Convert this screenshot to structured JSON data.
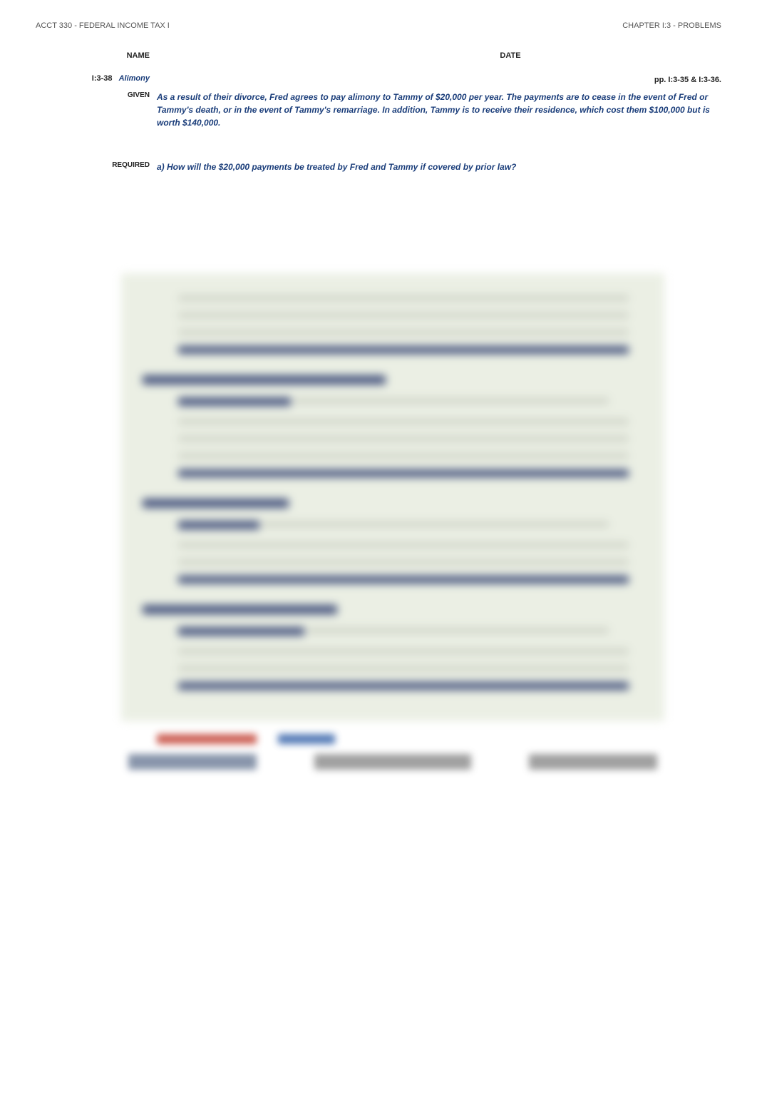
{
  "header": {
    "course": "ACCT 330 - FEDERAL INCOME TAX I",
    "chapter": "CHAPTER I:3 - PROBLEMS"
  },
  "labels": {
    "name": "NAME",
    "date": "DATE",
    "given": "GIVEN",
    "required": "REQUIRED"
  },
  "problem": {
    "number": "I:3-38",
    "topic": "Alimony",
    "pages": "pp. I:3-35 & I:3-36.",
    "given": "As a result of their divorce, Fred agrees to pay alimony to Tammy of $20,000 per year.  The payments are to cease in the event of Fred or Tammy's death, or in the event of Tammy's remarriage.  In addition, Tammy is to receive their residence, which cost them $100,000 but is worth $140,000.",
    "required_a": "a)  How will the $20,000 payments be treated by Fred and Tammy if covered by prior law?"
  }
}
